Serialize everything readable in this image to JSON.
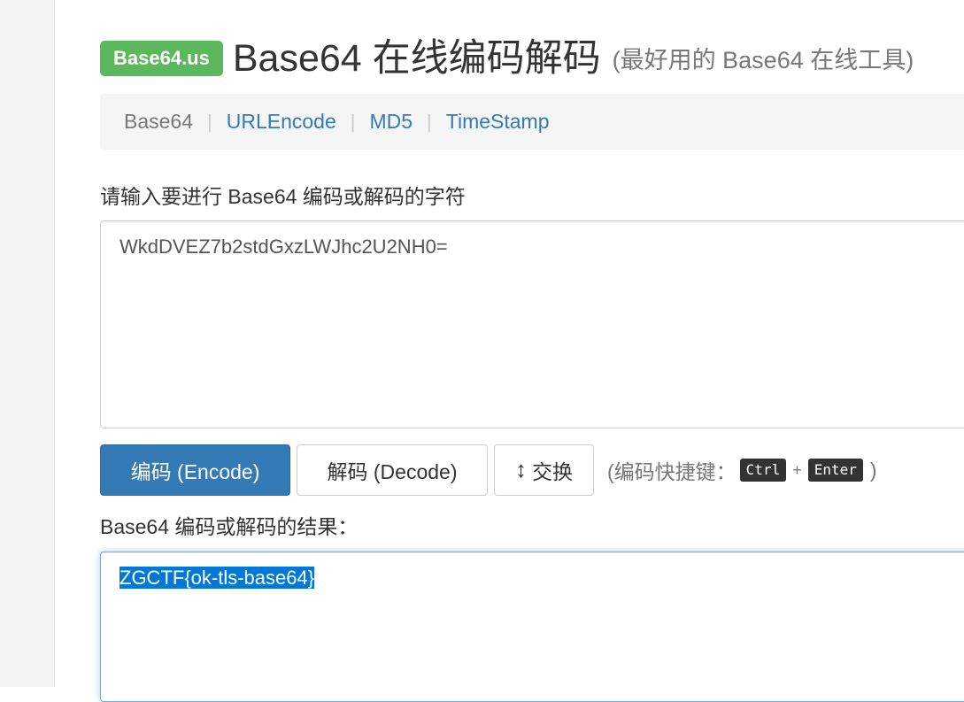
{
  "header": {
    "brand": "Base64.us",
    "title": "Base64 在线编码解码",
    "subtitle": "(最好用的 Base64 在线工具)"
  },
  "nav": {
    "items": [
      {
        "label": "Base64",
        "active": true
      },
      {
        "label": "URLEncode",
        "active": false
      },
      {
        "label": "MD5",
        "active": false
      },
      {
        "label": "TimeStamp",
        "active": false
      }
    ],
    "separator": "|"
  },
  "input": {
    "label": "请输入要进行 Base64 编码或解码的字符",
    "value": "WkdDVEZ7b2stdGxzLWJhc2U2NH0="
  },
  "buttons": {
    "encode": "编码 (Encode)",
    "decode": "解码 (Decode)",
    "swap": "交换",
    "swap_icon": "↕"
  },
  "shortcut": {
    "prefix": "(编码快捷键：",
    "key1": "Ctrl",
    "plus": "+",
    "key2": "Enter",
    "suffix": ")"
  },
  "output": {
    "label": "Base64 编码或解码的结果：",
    "value": "ZGCTF{ok-tls-base64}"
  },
  "colors": {
    "brand_green": "#5cb85c",
    "primary_blue": "#337ab7",
    "link_blue": "#337ab7",
    "selection_blue": "#0078d7"
  }
}
